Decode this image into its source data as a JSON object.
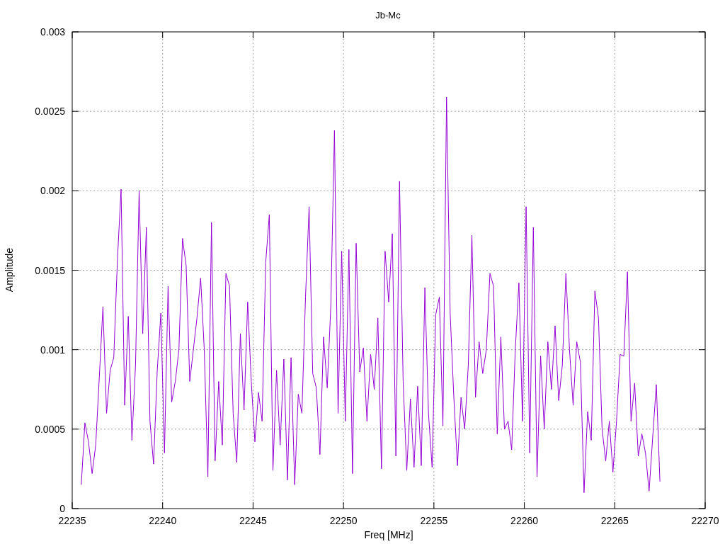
{
  "chart_data": {
    "type": "line",
    "title": "Jb-Mc",
    "xlabel": "Freq [MHz]",
    "ylabel": "Amplitude",
    "grid": true,
    "xlim": [
      22235,
      22270
    ],
    "ylim": [
      0,
      0.003
    ],
    "xticks": [
      22235,
      22240,
      22245,
      22250,
      22255,
      22260,
      22265,
      22270
    ],
    "yticks": [
      0,
      0.0005,
      0.001,
      0.0015,
      0.002,
      0.0025,
      0.003
    ],
    "x": [
      22235.5,
      22235.7,
      22235.9,
      22236.1,
      22236.3,
      22236.5,
      22236.7,
      22236.9,
      22237.1,
      22237.3,
      22237.5,
      22237.7,
      22237.9,
      22238.1,
      22238.3,
      22238.5,
      22238.7,
      22238.9,
      22239.1,
      22239.3,
      22239.5,
      22239.7,
      22239.9,
      22240.1,
      22240.3,
      22240.5,
      22240.7,
      22240.9,
      22241.1,
      22241.3,
      22241.5,
      22241.7,
      22241.9,
      22242.1,
      22242.3,
      22242.5,
      22242.7,
      22242.9,
      22243.1,
      22243.3,
      22243.5,
      22243.7,
      22243.9,
      22244.1,
      22244.3,
      22244.5,
      22244.7,
      22244.9,
      22245.1,
      22245.3,
      22245.5,
      22245.7,
      22245.9,
      22246.1,
      22246.3,
      22246.5,
      22246.7,
      22246.9,
      22247.1,
      22247.3,
      22247.5,
      22247.7,
      22247.9,
      22248.1,
      22248.3,
      22248.5,
      22248.7,
      22248.9,
      22249.1,
      22249.3,
      22249.5,
      22249.7,
      22249.9,
      22250.1,
      22250.3,
      22250.5,
      22250.7,
      22250.9,
      22251.1,
      22251.3,
      22251.5,
      22251.7,
      22251.9,
      22252.1,
      22252.3,
      22252.5,
      22252.7,
      22252.9,
      22253.1,
      22253.3,
      22253.5,
      22253.7,
      22253.9,
      22254.1,
      22254.3,
      22254.5,
      22254.7,
      22254.9,
      22255.1,
      22255.3,
      22255.5,
      22255.7,
      22255.9,
      22256.1,
      22256.3,
      22256.5,
      22256.7,
      22256.9,
      22257.1,
      22257.3,
      22257.5,
      22257.7,
      22257.9,
      22258.1,
      22258.3,
      22258.5,
      22258.7,
      22258.9,
      22259.1,
      22259.3,
      22259.5,
      22259.7,
      22259.9,
      22260.1,
      22260.3,
      22260.5,
      22260.7,
      22260.9,
      22261.1,
      22261.3,
      22261.5,
      22261.7,
      22261.9,
      22262.1,
      22262.3,
      22262.5,
      22262.7,
      22262.9,
      22263.1,
      22263.3,
      22263.5,
      22263.7,
      22263.9,
      22264.1,
      22264.3,
      22264.5,
      22264.7,
      22264.9,
      22265.1,
      22265.3,
      22265.5,
      22265.7,
      22265.9,
      22266.1,
      22266.3,
      22266.5,
      22266.7,
      22266.9,
      22267.1,
      22267.3,
      22267.5
    ],
    "series": [
      {
        "color": "#9400d3",
        "values": [
          0.00015,
          0.00054,
          0.00042,
          0.00022,
          0.0004,
          0.00083,
          0.00127,
          0.0006,
          0.00087,
          0.00095,
          0.00157,
          0.00201,
          0.00065,
          0.00121,
          0.00043,
          0.0009,
          0.002,
          0.0011,
          0.00177,
          0.00055,
          0.00028,
          0.00087,
          0.00123,
          0.00035,
          0.0014,
          0.00067,
          0.0008,
          0.001,
          0.0017,
          0.00153,
          0.0008,
          0.001,
          0.0012,
          0.00145,
          0.001,
          0.0002,
          0.0018,
          0.0003,
          0.0008,
          0.0004,
          0.00148,
          0.0014,
          0.0006,
          0.00029,
          0.0011,
          0.00062,
          0.0013,
          0.0008,
          0.00042,
          0.00073,
          0.00055,
          0.00155,
          0.00185,
          0.00024,
          0.00087,
          0.0004,
          0.00094,
          0.00018,
          0.00095,
          0.00015,
          0.00072,
          0.0006,
          0.00133,
          0.0019,
          0.00085,
          0.00076,
          0.00034,
          0.00108,
          0.00076,
          0.00128,
          0.00238,
          0.0006,
          0.00162,
          0.00055,
          0.00163,
          0.00022,
          0.00167,
          0.00086,
          0.00101,
          0.00055,
          0.00097,
          0.00075,
          0.0012,
          0.00025,
          0.00162,
          0.0013,
          0.00173,
          0.00033,
          0.00206,
          0.0008,
          0.00024,
          0.00069,
          0.00026,
          0.00077,
          0.00027,
          0.00139,
          0.0006,
          0.00026,
          0.00122,
          0.00133,
          0.00052,
          0.00259,
          0.00123,
          0.0007,
          0.00027,
          0.0007,
          0.0005,
          0.0009,
          0.00172,
          0.0007,
          0.00105,
          0.00085,
          0.001,
          0.00148,
          0.0014,
          0.00047,
          0.00108,
          0.0005,
          0.00055,
          0.00037,
          0.001,
          0.00142,
          0.00055,
          0.0019,
          0.00035,
          0.00177,
          0.0002,
          0.00096,
          0.0005,
          0.00105,
          0.00075,
          0.00115,
          0.00068,
          0.0009,
          0.00148,
          0.001,
          0.00065,
          0.00105,
          0.00092,
          0.0001,
          0.00061,
          0.00043,
          0.00137,
          0.0012,
          0.0005,
          0.0003,
          0.00055,
          0.00023,
          0.00055,
          0.00097,
          0.00096,
          0.00149,
          0.00055,
          0.00079,
          0.00033,
          0.00047,
          0.00035,
          0.00011,
          0.00045,
          0.00078,
          0.00017
        ]
      }
    ]
  }
}
